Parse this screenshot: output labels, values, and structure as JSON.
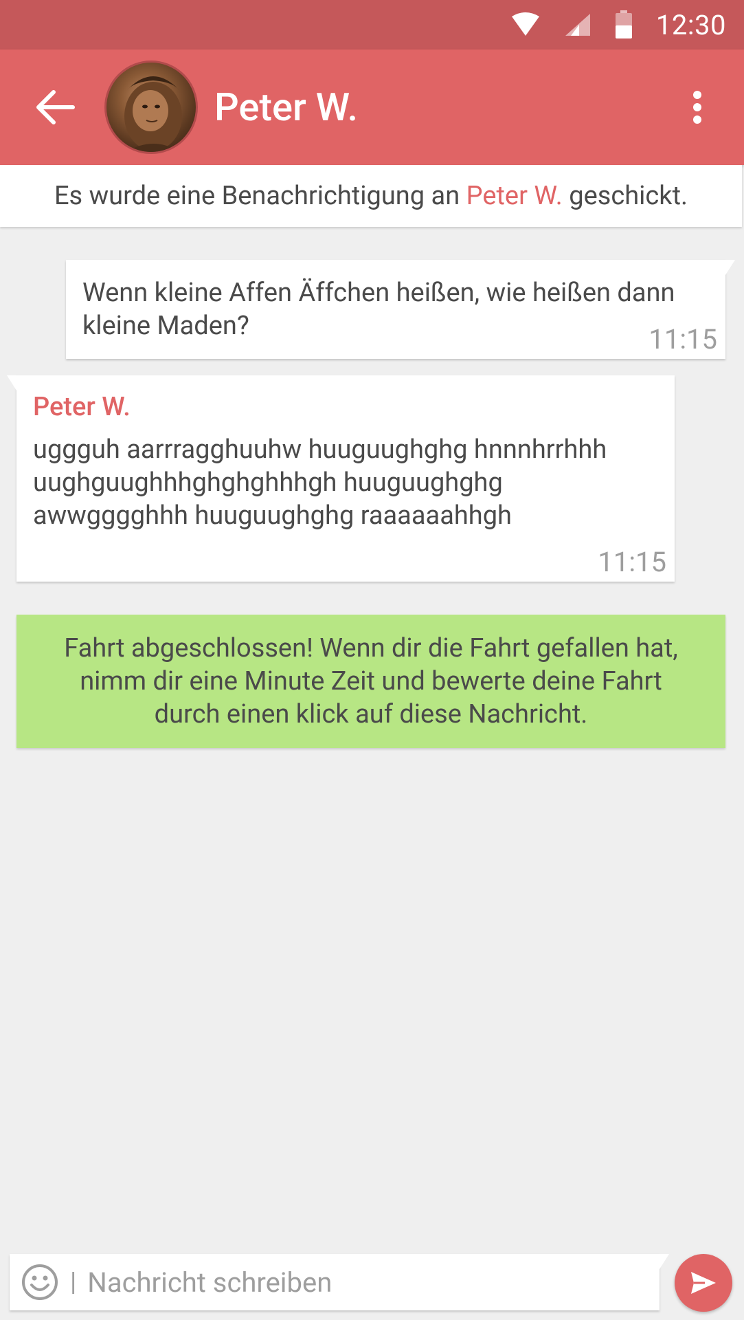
{
  "status_bar": {
    "time": "12:30",
    "icons": [
      "wifi-icon",
      "cell-signal-icon",
      "battery-icon"
    ]
  },
  "app_bar": {
    "contact_name": "Peter W.",
    "back_icon": "arrow-back-icon",
    "menu_icon": "more-vert-icon"
  },
  "notice": {
    "prefix": "Es wurde eine Benachrichtigung an ",
    "name": "Peter W.",
    "suffix": " geschickt."
  },
  "messages": [
    {
      "direction": "outgoing",
      "text": "Wenn kleine Affen Äffchen heißen, wie heißen dann kleine Maden?",
      "time": "11:15"
    },
    {
      "direction": "incoming",
      "sender": "Peter W.",
      "text": "uggguh aarrragghuuhw huuguughghg hnnnhrrhhh uughguughhhghghghhhgh huuguughghg awwgggghhh huuguughghg raaaaaahhgh",
      "time": "11:15"
    }
  ],
  "system_message": {
    "text": "Fahrt abgeschlossen! Wenn dir die Fahrt gefallen hat, nimm dir eine Minute Zeit und bewerte deine Fahrt durch einen klick auf diese Nachricht."
  },
  "composer": {
    "placeholder": "Nachricht schreiben",
    "value": "",
    "emoji_icon": "emoji-icon",
    "send_icon": "send-icon"
  },
  "colors": {
    "status_bar": "#c5585a",
    "app_bar": "#e06465",
    "accent": "#e06465",
    "system_message_bg": "#b7e684",
    "background": "#efefef"
  }
}
